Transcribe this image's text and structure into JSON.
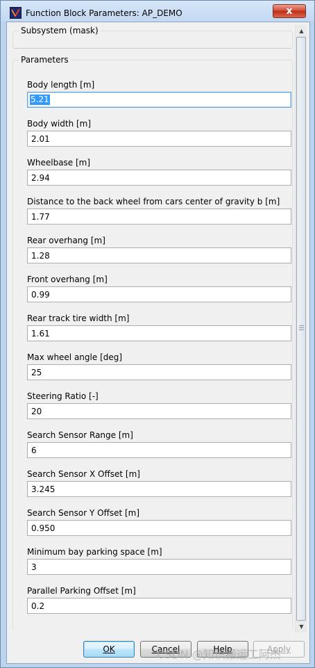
{
  "window": {
    "title": "Function Block Parameters: AP_DEMO",
    "close_label": "x"
  },
  "mask_group": {
    "legend": "Subsystem (mask)"
  },
  "parameters": {
    "legend": "Parameters",
    "items": [
      {
        "label": "Body length [m]",
        "value": "5.21"
      },
      {
        "label": "Body width [m]",
        "value": "2.01"
      },
      {
        "label": "Wheelbase [m]",
        "value": "2.94"
      },
      {
        "label": "Distance to the back wheel from cars center of gravity b [m]",
        "value": "1.77"
      },
      {
        "label": "Rear overhang [m]",
        "value": "1.28"
      },
      {
        "label": "Front overhang [m]",
        "value": "0.99"
      },
      {
        "label": "Rear track tire width [m]",
        "value": "1.61"
      },
      {
        "label": "Max wheel angle [deg]",
        "value": "25"
      },
      {
        "label": "Steering Ratio [-]",
        "value": "20"
      },
      {
        "label": "Search Sensor Range [m]",
        "value": "6"
      },
      {
        "label": "Search Sensor X Offset [m]",
        "value": "3.245"
      },
      {
        "label": "Search Sensor Y Offset [m]",
        "value": "0.950"
      },
      {
        "label": "Minimum bay parking space [m]",
        "value": "3"
      },
      {
        "label": "Parallel Parking Offset [m]",
        "value": "0.2"
      }
    ]
  },
  "buttons": {
    "ok": "OK",
    "cancel": "Cancel",
    "help": "Help",
    "apply": "Apply"
  },
  "watermark": "CSDN @知识搬运工阿杰"
}
